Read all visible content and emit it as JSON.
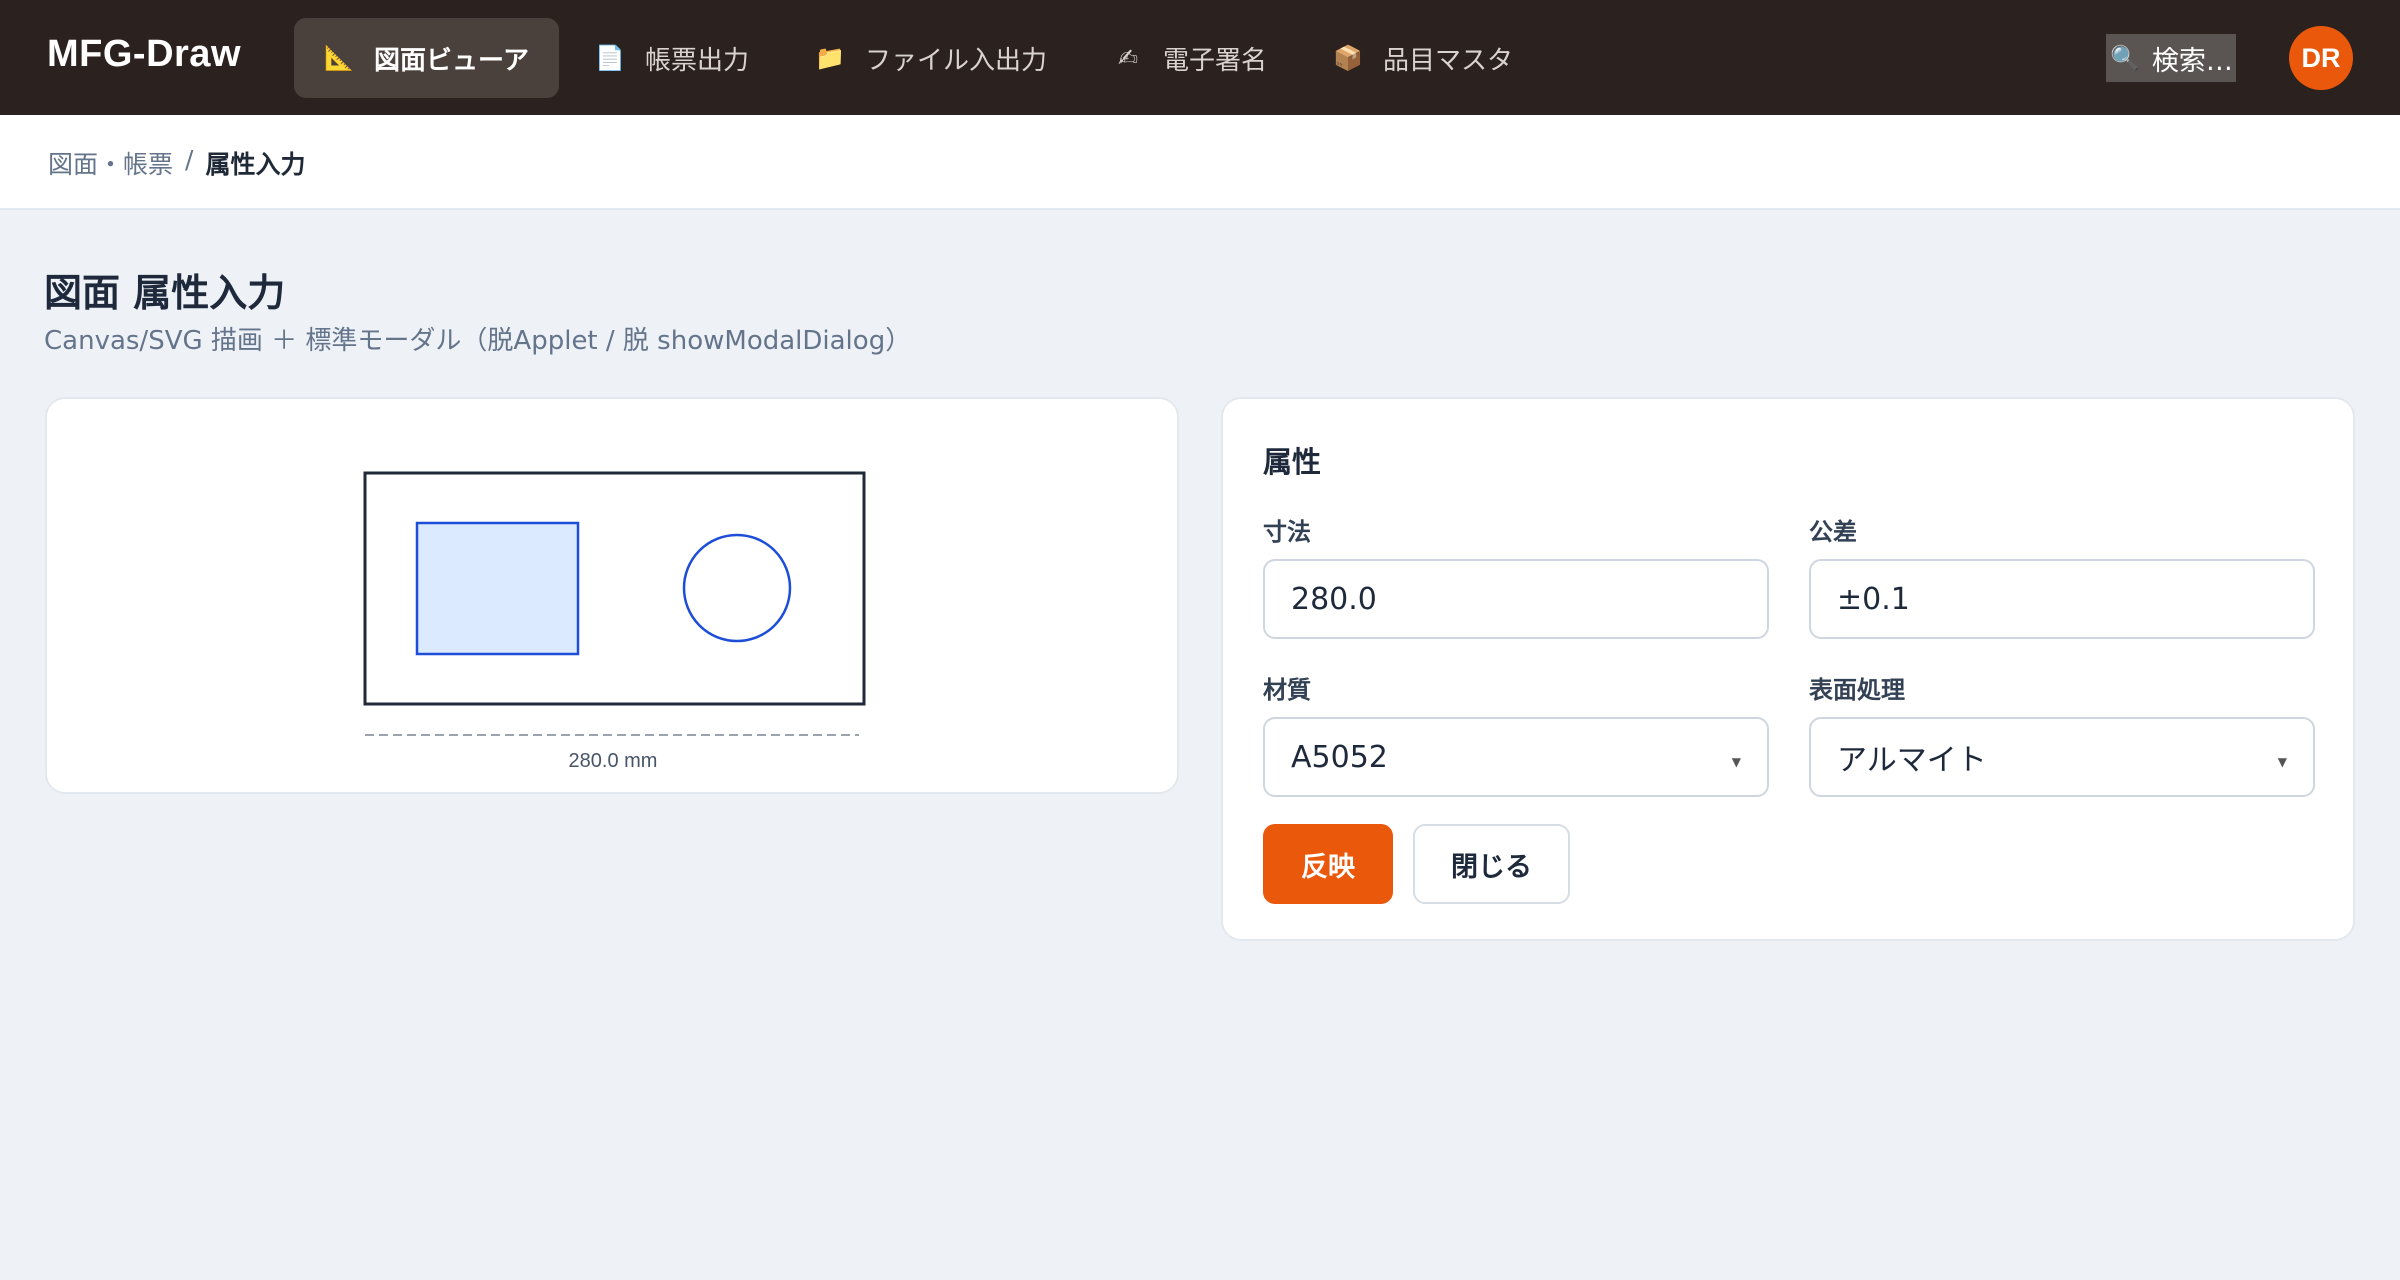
{
  "app": {
    "brand": "MFG-Draw"
  },
  "nav": [
    {
      "icon": "📐",
      "icon_name": "ruler-triangle-icon",
      "label": "図面ビューア",
      "active": true
    },
    {
      "icon": "📄",
      "icon_name": "document-icon",
      "label": "帳票出力",
      "active": false
    },
    {
      "icon": "📁",
      "icon_name": "folder-icon",
      "label": "ファイル入出力",
      "active": false
    },
    {
      "icon": "✍",
      "icon_name": "writing-hand-icon",
      "label": "電子署名",
      "active": false
    },
    {
      "icon": "📦",
      "icon_name": "package-icon",
      "label": "品目マスタ",
      "active": false
    }
  ],
  "search": {
    "icon": "🔍",
    "label": "検索…"
  },
  "user": {
    "initials": "DR"
  },
  "breadcrumb": {
    "parent": "図面・帳票",
    "separator": "/",
    "current": "属性入力"
  },
  "page": {
    "title": "図面 属性入力",
    "subtitle": "Canvas/SVG 描画 ＋ 標準モーダル（脱Applet / 脱 showModalDialog）"
  },
  "drawing": {
    "dimension_label": "280.0 mm"
  },
  "attributes": {
    "title": "属性",
    "fields": {
      "dimension": {
        "label": "寸法",
        "value": "280.0"
      },
      "tolerance": {
        "label": "公差",
        "value": "±0.1"
      },
      "material": {
        "label": "材質",
        "value": "A5052"
      },
      "surface": {
        "label": "表面処理",
        "value": "アルマイト"
      }
    },
    "buttons": {
      "apply": "反映",
      "close": "閉じる"
    }
  },
  "colors": {
    "topbar": "#2b211e",
    "accent": "#ea580c",
    "shape_stroke": "#1d4ed8",
    "shape_fill": "#dbeafe"
  }
}
